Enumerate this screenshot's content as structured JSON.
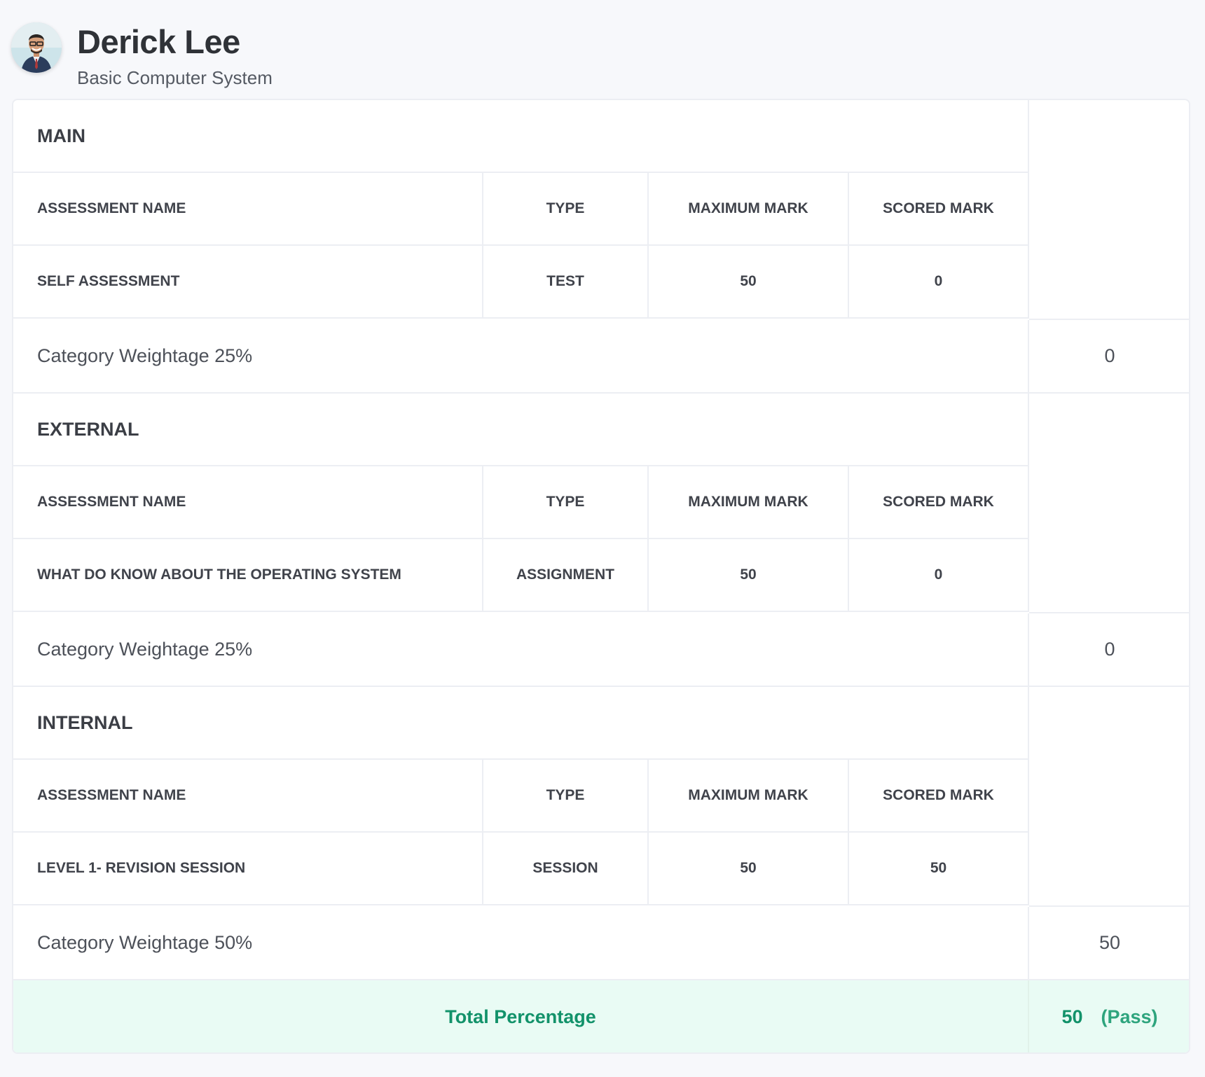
{
  "student": {
    "name": "Derick Lee",
    "course": "Basic Computer System"
  },
  "headers": {
    "assessment_name": "ASSESSMENT NAME",
    "type": "TYPE",
    "maximum_mark": "MAXIMUM MARK",
    "scored_mark": "SCORED MARK"
  },
  "sections": [
    {
      "title": "MAIN",
      "rows": [
        {
          "name": "SELF ASSESSMENT",
          "type": "TEST",
          "max": "50",
          "scored": "0"
        }
      ],
      "weightage_label": "Category Weightage 25%",
      "weightage_value": "0"
    },
    {
      "title": "EXTERNAL",
      "rows": [
        {
          "name": "WHAT DO KNOW ABOUT THE OPERATING SYSTEM",
          "type": "ASSIGNMENT",
          "max": "50",
          "scored": "0"
        }
      ],
      "weightage_label": "Category Weightage 25%",
      "weightage_value": "0"
    },
    {
      "title": "INTERNAL",
      "rows": [
        {
          "name": "LEVEL 1- REVISION SESSION",
          "type": "SESSION",
          "max": "50",
          "scored": "50"
        }
      ],
      "weightage_label": "Category Weightage 50%",
      "weightage_value": "50"
    }
  ],
  "total": {
    "label": "Total Percentage",
    "value": "50",
    "status": "(Pass)"
  },
  "colors": {
    "accent_green": "#12926a",
    "total_bg": "#e9fbf4",
    "border": "#eceef3"
  }
}
